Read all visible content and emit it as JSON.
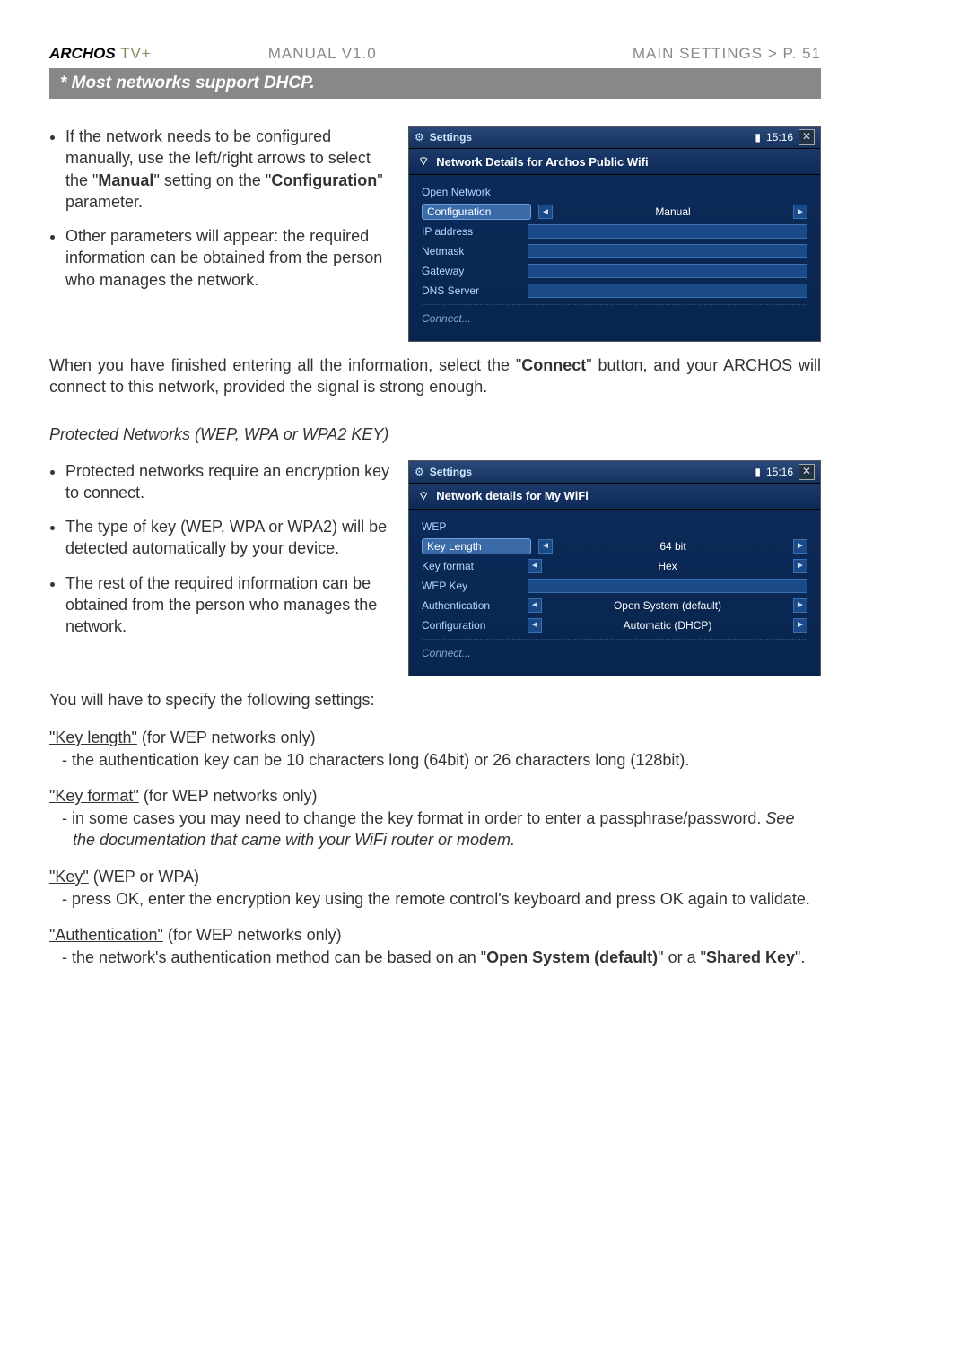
{
  "header": {
    "brand": "ARCHOS",
    "tv": " TV+",
    "center": "MANUAL V1.0",
    "right": "MAIN SETTINGS   >   P. 51"
  },
  "bar_note": "* Most networks support DHCP.",
  "col1": {
    "bullets1": [
      "If the network needs to be configured manually, use the left/right arrows to select the \"Manual\" setting on the \"Configuration\" parameter.",
      "Other parameters will appear: the required information can be obtained from the person who manages the network."
    ],
    "para1a": "When you have finished entering all the information, select the \"",
    "para1b": "Connect",
    "para1c": "\" button, and your ARCHOS will connect to this network, provided the signal is strong enough.",
    "sub_heading": "Protected Networks (WEP, WPA or WPA2 KEY)",
    "bullets2": [
      "Protected networks require an encryption key to connect.",
      "The type of key (WEP, WPA or WPA2) will be detected automatically by your device.",
      "The rest of the required information can be obtained from the person who manages the network."
    ],
    "spec_intro": "You will have to specify the following settings:",
    "settings": [
      {
        "name": "\"Key length\"",
        "paren": " (for WEP networks only)",
        "lines": [
          "- the authentication key can be 10 characters long (64bit) or 26 characters long (128bit)."
        ]
      },
      {
        "name": "\"Key format\"",
        "paren": " (for WEP networks only)",
        "lines": [
          "- in some cases you may need to change the key format in order to enter a passphrase/password. See the documentation that came with your WiFi router or modem."
        ]
      },
      {
        "name": "\"Key\"",
        "paren": " (WEP or WPA)",
        "lines": [
          "- press OK, enter the encryption key using the remote control's keyboard and press OK again to validate."
        ]
      },
      {
        "name": "\"Authentication\"",
        "paren": " (for WEP networks only)",
        "lines": [
          "- the network's authentication method can be based on an \"Open System (default)\" or a \"Shared Key\"."
        ]
      }
    ]
  },
  "panel1": {
    "title": "Settings",
    "clock": "15:16",
    "subtitle": "Network Details for Archos Public Wifi",
    "rows": [
      {
        "label": "Open Network",
        "type": "plain"
      },
      {
        "label": "Configuration",
        "type": "spinner",
        "value": "Manual",
        "selected": true
      },
      {
        "label": "IP address",
        "type": "input"
      },
      {
        "label": "Netmask",
        "type": "input"
      },
      {
        "label": "Gateway",
        "type": "input"
      },
      {
        "label": "DNS Server",
        "type": "input"
      },
      {
        "label": "Connect...",
        "type": "connect"
      }
    ]
  },
  "panel2": {
    "title": "Settings",
    "clock": "15:16",
    "subtitle": "Network details for My WiFi",
    "rows": [
      {
        "label": "WEP",
        "type": "plain"
      },
      {
        "label": "Key Length",
        "type": "spinner",
        "value": "64 bit",
        "selected": true
      },
      {
        "label": "Key format",
        "type": "spinner",
        "value": "Hex"
      },
      {
        "label": "WEP Key",
        "type": "input"
      },
      {
        "label": "Authentication",
        "type": "spinner",
        "value": "Open System (default)"
      },
      {
        "label": "Configuration",
        "type": "spinner",
        "value": "Automatic (DHCP)"
      },
      {
        "label": "Connect...",
        "type": "connect"
      }
    ]
  }
}
